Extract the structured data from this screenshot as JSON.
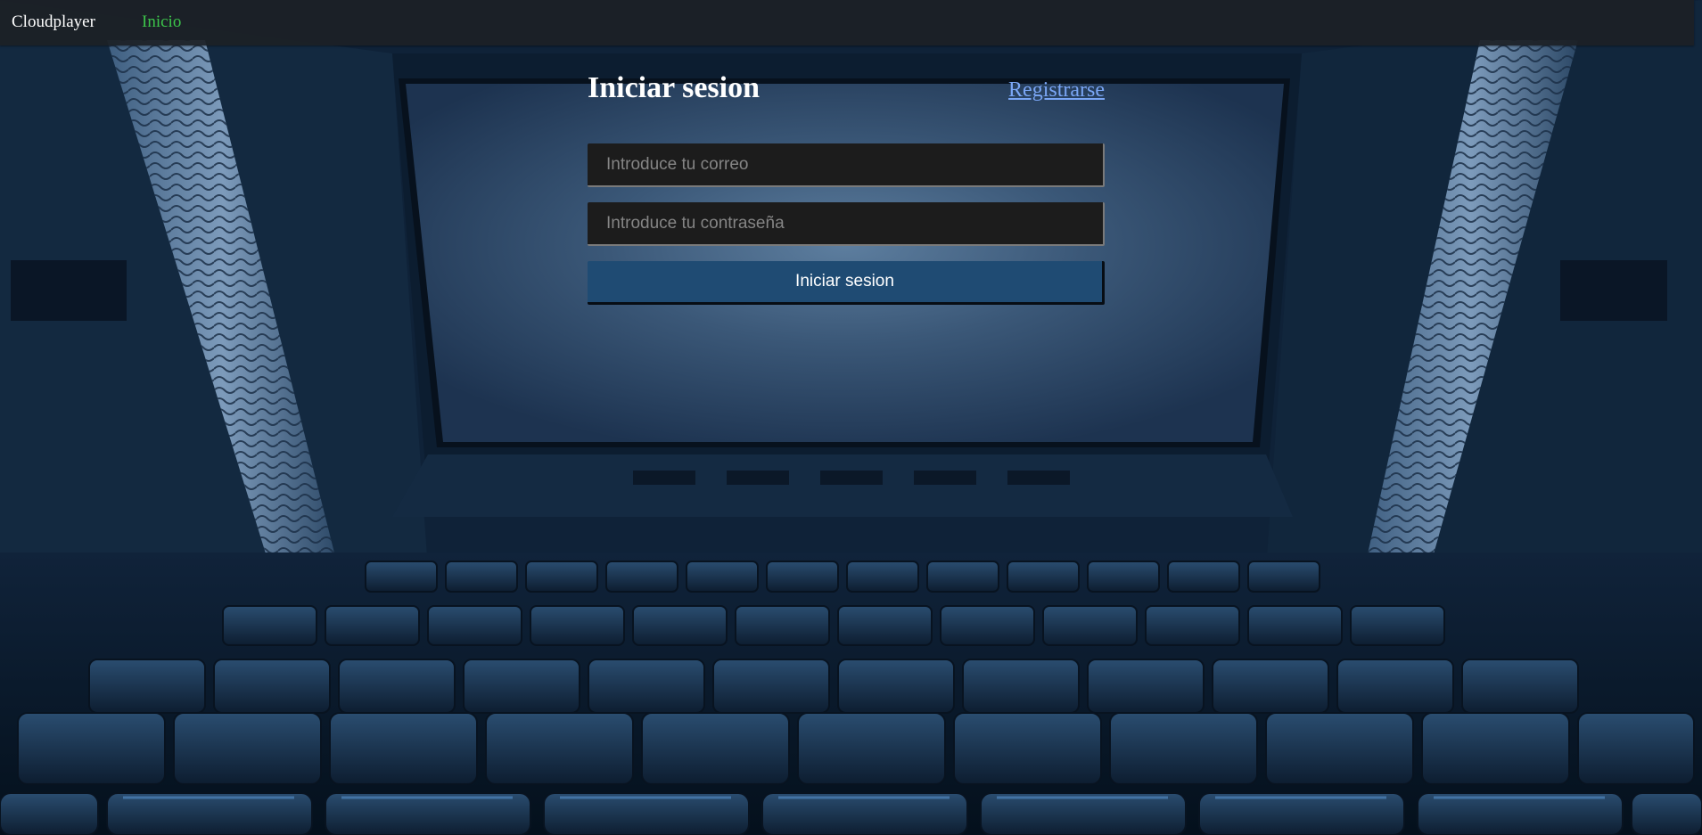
{
  "navbar": {
    "brand": "Cloudplayer",
    "links": [
      {
        "label": "Inicio",
        "color": "#3cc44a"
      }
    ]
  },
  "login": {
    "title": "Iniciar sesion",
    "register_link": "Registrarse",
    "email_placeholder": "Introduce tu correo",
    "email_value": "",
    "password_placeholder": "Introduce tu contraseña",
    "password_value": "",
    "submit_label": "Iniciar sesion"
  },
  "colors": {
    "navbar_bg": "#1c2026",
    "nav_link_active": "#3cc44a",
    "register_link": "#7aa6f5",
    "input_bg": "#1c1c1c",
    "button_bg": "#1f4b73"
  }
}
